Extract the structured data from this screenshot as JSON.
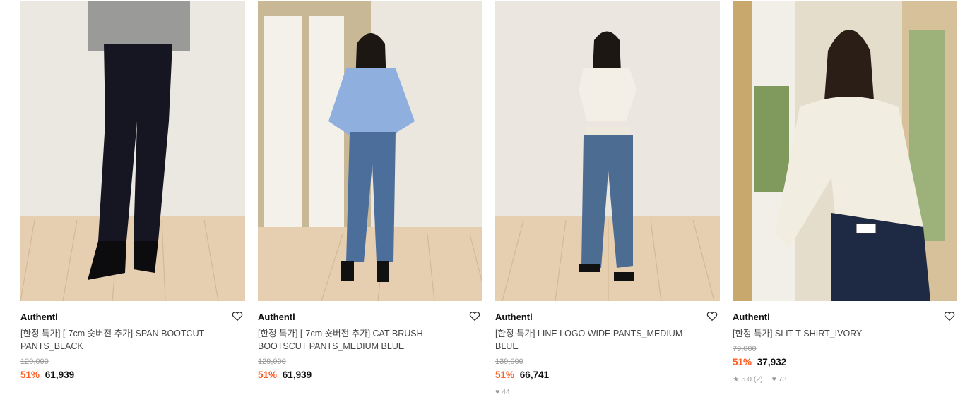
{
  "products": [
    {
      "brand": "Authentl",
      "title": "[한정 특가] [-7cm 숏버전 추가] SPAN BOOTCUT PANTS_BLACK",
      "original_price": "129,000",
      "discount": "51%",
      "price": "61,939",
      "likes": "",
      "rating": ""
    },
    {
      "brand": "Authentl",
      "title": "[한정 특가] [-7cm 숏버전 추가] CAT BRUSH BOOTSCUT PANTS_MEDIUM BLUE",
      "original_price": "129,000",
      "discount": "51%",
      "price": "61,939",
      "likes": "",
      "rating": ""
    },
    {
      "brand": "Authentl",
      "title": "[한정 특가] LINE LOGO WIDE PANTS_MEDIUM BLUE",
      "original_price": "139,000",
      "discount": "51%",
      "price": "66,741",
      "likes": "♥ 44",
      "rating": ""
    },
    {
      "brand": "Authentl",
      "title": "[한정 특가] SLIT T-SHIRT_IVORY",
      "original_price": "79,000",
      "discount": "51%",
      "price": "37,932",
      "likes": "♥ 73",
      "rating": "★ 5.0 (2)"
    }
  ],
  "colors": {
    "discount": "#ff5a1f",
    "wall": "#ebe7df",
    "floor": "#e3ccb0"
  },
  "icons": {
    "wishlist": "heart-outline-icon"
  }
}
